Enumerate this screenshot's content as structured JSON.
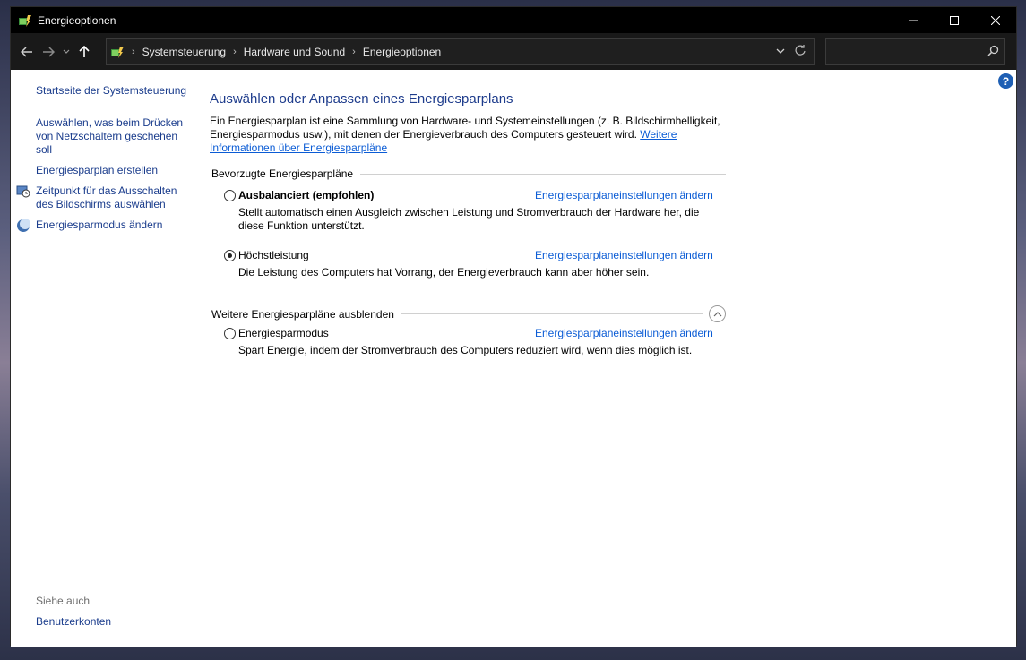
{
  "window": {
    "title": "Energieoptionen"
  },
  "breadcrumb": [
    "Systemsteuerung",
    "Hardware und Sound",
    "Energieoptionen"
  ],
  "search": {
    "placeholder": ""
  },
  "left_pane": {
    "links": [
      "Startseite der Systemsteuerung",
      "Auswählen, was beim Drücken von Netzschaltern geschehen soll",
      "Energiesparplan erstellen",
      "Zeitpunkt für das Ausschalten des Bildschirms auswählen",
      "Energiesparmodus ändern"
    ],
    "see_also_label": "Siehe auch",
    "see_also_links": [
      "Benutzerkonten"
    ]
  },
  "main": {
    "title": "Auswählen oder Anpassen eines Energiesparplans",
    "intro_text": "Ein Energiesparplan ist eine Sammlung von Hardware- und Systemeinstellungen (z. B. Bildschirmhelligkeit, Energiesparmodus usw.), mit denen der Energieverbrauch des Computers gesteuert wird. ",
    "intro_link": "Weitere Informationen über Energiesparpläne",
    "preferred_group": "Bevorzugte Energiesparpläne",
    "more_group": "Weitere Energiesparpläne ausblenden",
    "change_link": "Energiesparplaneinstellungen ändern",
    "plans": [
      {
        "name": "Ausbalanciert (empfohlen)",
        "description": "Stellt automatisch einen Ausgleich zwischen Leistung und Stromverbrauch der Hardware her, die diese Funktion unterstützt.",
        "selected": false
      },
      {
        "name": "Höchstleistung",
        "description": "Die Leistung des Computers hat Vorrang, der Energieverbrauch kann aber höher sein.",
        "selected": true
      },
      {
        "name": "Energiesparmodus",
        "description": "Spart Energie, indem der Stromverbrauch des Computers reduziert wird, wenn dies möglich ist.",
        "selected": false
      }
    ]
  },
  "colors": {
    "link": "#0b5cd5",
    "nav_link": "#1a3c8c",
    "title_bar": "#000000"
  }
}
